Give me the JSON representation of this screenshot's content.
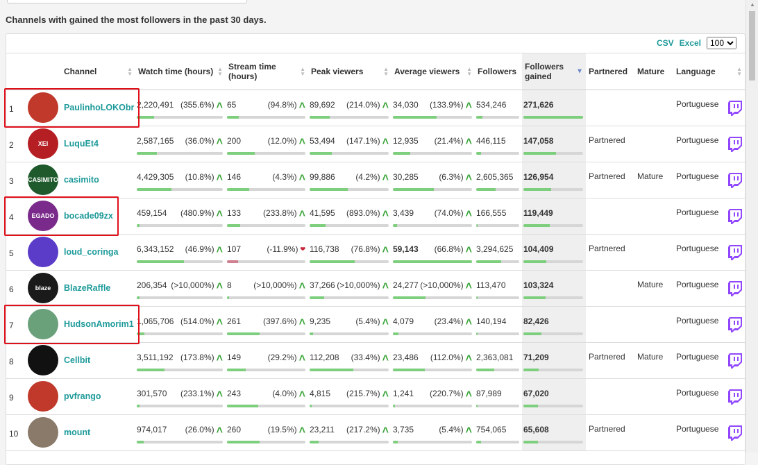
{
  "heading": "Channels with gained the most followers in the past 30 days.",
  "toolbar": {
    "csv": "CSV",
    "excel": "Excel",
    "page_size": "100"
  },
  "columns": {
    "channel": "Channel",
    "watch_time": "Watch time (hours)",
    "stream_time": "Stream time (hours)",
    "peak_viewers": "Peak viewers",
    "avg_viewers": "Average viewers",
    "followers": "Followers",
    "followers_gained": "Followers gained",
    "partnered": "Partnered",
    "mature": "Mature",
    "language": "Language"
  },
  "colors": {
    "accent": "#1e9a9a",
    "up": "#3ca63c",
    "down": "#c8283c",
    "bar_fill": "#7dcf7d",
    "highlight": "#e0101b",
    "twitch": "#9147ff"
  },
  "rows": [
    {
      "rank": "1",
      "name": "PaulinhoLOKObr",
      "avatar": "",
      "avatar_color": "#c0392b",
      "highlighted": true,
      "watch": "2,220,491",
      "watch_pct": "(355.6%)",
      "watch_dir": "up",
      "watch_level": 0.2,
      "stream": "65",
      "stream_pct": "(94.8%)",
      "stream_dir": "up",
      "stream_level": 0.15,
      "peak": "89,692",
      "peak_pct": "(214.0%)",
      "peak_dir": "up",
      "peak_level": 0.25,
      "avg": "34,030",
      "avg_pct": "(133.9%)",
      "avg_dir": "up",
      "avg_level": 0.55,
      "followers": "534,246",
      "followers_level": 0.15,
      "gained": "271,626",
      "gained_level": 1.0,
      "partnered": "",
      "mature": "",
      "language": "Portuguese"
    },
    {
      "rank": "2",
      "name": "LuquEt4",
      "avatar": "XEI",
      "avatar_color": "#b51f24",
      "highlighted": false,
      "watch": "2,587,165",
      "watch_pct": "(36.0%)",
      "watch_dir": "up",
      "watch_level": 0.23,
      "stream": "200",
      "stream_pct": "(12.0%)",
      "stream_dir": "up",
      "stream_level": 0.35,
      "peak": "53,494",
      "peak_pct": "(147.1%)",
      "peak_dir": "up",
      "peak_level": 0.28,
      "avg": "12,935",
      "avg_pct": "(21.4%)",
      "avg_dir": "up",
      "avg_level": 0.22,
      "followers": "446,115",
      "followers_level": 0.12,
      "gained": "147,058",
      "gained_level": 0.55,
      "partnered": "Partnered",
      "mature": "",
      "language": "Portuguese"
    },
    {
      "rank": "3",
      "name": "casimito",
      "avatar": "CASIMITO",
      "avatar_color": "#1e5a2c",
      "highlighted": false,
      "watch": "4,429,305",
      "watch_pct": "(10.8%)",
      "watch_dir": "up",
      "watch_level": 0.4,
      "stream": "146",
      "stream_pct": "(4.3%)",
      "stream_dir": "up",
      "stream_level": 0.28,
      "peak": "99,886",
      "peak_pct": "(4.2%)",
      "peak_dir": "up",
      "peak_level": 0.48,
      "avg": "30,285",
      "avg_pct": "(6.3%)",
      "avg_dir": "up",
      "avg_level": 0.52,
      "followers": "2,605,365",
      "followers_level": 0.45,
      "gained": "126,954",
      "gained_level": 0.47,
      "partnered": "Partnered",
      "mature": "Mature",
      "language": "Portuguese"
    },
    {
      "rank": "4",
      "name": "bocade09zx",
      "avatar": "EGADO",
      "avatar_color": "#7a2a8a",
      "highlighted": true,
      "watch": "459,154",
      "watch_pct": "(480.9%)",
      "watch_dir": "up",
      "watch_level": 0.03,
      "stream": "133",
      "stream_pct": "(233.8%)",
      "stream_dir": "up",
      "stream_level": 0.17,
      "peak": "41,595",
      "peak_pct": "(893.0%)",
      "peak_dir": "up",
      "peak_level": 0.2,
      "avg": "3,439",
      "avg_pct": "(74.0%)",
      "avg_dir": "up",
      "avg_level": 0.05,
      "followers": "166,555",
      "followers_level": 0.04,
      "gained": "119,449",
      "gained_level": 0.44,
      "partnered": "",
      "mature": "",
      "language": "Portuguese"
    },
    {
      "rank": "5",
      "name": "loud_coringa",
      "avatar": "",
      "avatar_color": "#5a3cc8",
      "highlighted": false,
      "watch": "6,343,152",
      "watch_pct": "(46.9%)",
      "watch_dir": "up",
      "watch_level": 0.55,
      "stream": "107",
      "stream_pct": "(-11.9%)",
      "stream_dir": "down",
      "stream_level": 0.14,
      "peak": "116,738",
      "peak_pct": "(76.8%)",
      "peak_dir": "up",
      "peak_level": 0.57,
      "avg": "59,143",
      "avg_pct": "(66.8%)",
      "avg_dir": "up",
      "avg_level": 1.0,
      "avg_bold": true,
      "followers": "3,294,625",
      "followers_level": 0.58,
      "gained": "104,409",
      "gained_level": 0.38,
      "partnered": "Partnered",
      "mature": "",
      "language": "Portuguese"
    },
    {
      "rank": "6",
      "name": "BlazeRaffle",
      "avatar": "blaze",
      "avatar_color": "#1a1a1a",
      "highlighted": false,
      "watch": "206,354",
      "watch_pct": "(>10,000%)",
      "watch_dir": "up",
      "watch_level": 0.02,
      "stream": "8",
      "stream_pct": "(>10,000%)",
      "stream_dir": "up",
      "stream_level": 0.02,
      "peak": "37,266",
      "peak_pct": "(>10,000%)",
      "peak_dir": "up",
      "peak_level": 0.18,
      "avg": "24,277",
      "avg_pct": "(>10,000%)",
      "avg_dir": "up",
      "avg_level": 0.41,
      "followers": "113,470",
      "followers_level": 0.02,
      "gained": "103,324",
      "gained_level": 0.37,
      "partnered": "",
      "mature": "Mature",
      "language": "Portuguese"
    },
    {
      "rank": "7",
      "name": "HudsonAmorim1",
      "avatar": "",
      "avatar_color": "#6aa07a",
      "highlighted": true,
      "watch": "1,065,706",
      "watch_pct": "(514.0%)",
      "watch_dir": "up",
      "watch_level": 0.09,
      "stream": "261",
      "stream_pct": "(397.6%)",
      "stream_dir": "up",
      "stream_level": 0.42,
      "peak": "9,235",
      "peak_pct": "(5.4%)",
      "peak_dir": "up",
      "peak_level": 0.04,
      "avg": "4,079",
      "avg_pct": "(23.4%)",
      "avg_dir": "up",
      "avg_level": 0.07,
      "followers": "140,194",
      "followers_level": 0.03,
      "gained": "82,426",
      "gained_level": 0.3,
      "partnered": "",
      "mature": "",
      "language": "Portuguese"
    },
    {
      "rank": "8",
      "name": "Cellbit",
      "avatar": "",
      "avatar_color": "#111111",
      "highlighted": false,
      "watch": "3,511,192",
      "watch_pct": "(173.8%)",
      "watch_dir": "up",
      "watch_level": 0.32,
      "stream": "149",
      "stream_pct": "(29.2%)",
      "stream_dir": "up",
      "stream_level": 0.24,
      "peak": "112,208",
      "peak_pct": "(33.4%)",
      "peak_dir": "up",
      "peak_level": 0.55,
      "avg": "23,486",
      "avg_pct": "(112.0%)",
      "avg_dir": "up",
      "avg_level": 0.4,
      "followers": "2,363,081",
      "followers_level": 0.42,
      "gained": "71,209",
      "gained_level": 0.26,
      "partnered": "Partnered",
      "mature": "Mature",
      "language": "Portuguese"
    },
    {
      "rank": "9",
      "name": "pvfrango",
      "avatar": "",
      "avatar_color": "#c0392b",
      "highlighted": false,
      "watch": "301,570",
      "watch_pct": "(233.1%)",
      "watch_dir": "up",
      "watch_level": 0.02,
      "stream": "243",
      "stream_pct": "(4.0%)",
      "stream_dir": "up",
      "stream_level": 0.4,
      "peak": "4,815",
      "peak_pct": "(215.7%)",
      "peak_dir": "up",
      "peak_level": 0.02,
      "avg": "1,241",
      "avg_pct": "(220.7%)",
      "avg_dir": "up",
      "avg_level": 0.02,
      "followers": "87,989",
      "followers_level": 0.02,
      "gained": "67,020",
      "gained_level": 0.24,
      "partnered": "",
      "mature": "",
      "language": "Portuguese"
    },
    {
      "rank": "10",
      "name": "mount",
      "avatar": "",
      "avatar_color": "#8a7a6a",
      "highlighted": false,
      "watch": "974,017",
      "watch_pct": "(26.0%)",
      "watch_dir": "up",
      "watch_level": 0.08,
      "stream": "260",
      "stream_pct": "(19.5%)",
      "stream_dir": "up",
      "stream_level": 0.42,
      "peak": "23,211",
      "peak_pct": "(217.2%)",
      "peak_dir": "up",
      "peak_level": 0.11,
      "avg": "3,735",
      "avg_pct": "(5.4%)",
      "avg_dir": "up",
      "avg_level": 0.06,
      "followers": "754,065",
      "followers_level": 0.12,
      "gained": "65,608",
      "gained_level": 0.24,
      "partnered": "Partnered",
      "mature": "",
      "language": "Portuguese"
    }
  ]
}
